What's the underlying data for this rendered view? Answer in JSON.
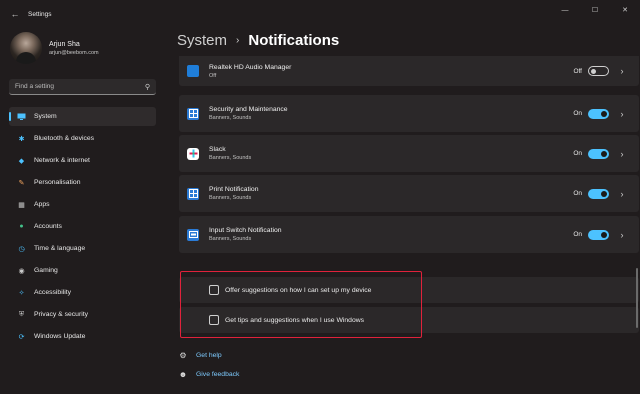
{
  "window": {
    "back_icon": "back-arrow-icon",
    "title": "Settings",
    "controls": [
      "minimize-icon",
      "maximize-icon",
      "close-icon"
    ]
  },
  "profile": {
    "name": "Arjun Sha",
    "email": "arjun@beebom.com"
  },
  "search": {
    "placeholder": "Find a setting",
    "value": "",
    "icon": "search-icon"
  },
  "sidebar": {
    "items": [
      {
        "label": "System",
        "icon": "system-icon",
        "active": true,
        "color": "#4cc2ff"
      },
      {
        "label": "Bluetooth & devices",
        "icon": "bluetooth-icon",
        "color": "#4cc2ff"
      },
      {
        "label": "Network & internet",
        "icon": "wifi-icon",
        "color": "#4cc2ff"
      },
      {
        "label": "Personalisation",
        "icon": "brush-icon",
        "color": "#f0a35e"
      },
      {
        "label": "Apps",
        "icon": "apps-icon",
        "color": "#c9c9c9"
      },
      {
        "label": "Accounts",
        "icon": "account-icon",
        "color": "#43c08a"
      },
      {
        "label": "Time & language",
        "icon": "globe-clock-icon",
        "color": "#4cc2ff"
      },
      {
        "label": "Gaming",
        "icon": "gamepad-icon",
        "color": "#c9c9c9"
      },
      {
        "label": "Accessibility",
        "icon": "accessibility-icon",
        "color": "#4cc2ff"
      },
      {
        "label": "Privacy & security",
        "icon": "shield-icon",
        "color": "#c9c9c9"
      },
      {
        "label": "Windows Update",
        "icon": "update-icon",
        "color": "#4cc2ff"
      }
    ]
  },
  "header": {
    "parent": "System",
    "separator": "›",
    "current": "Notifications"
  },
  "apps": [
    {
      "name": "Realtek HD Audio Manager",
      "sub": "Off",
      "state": "Off",
      "on": false,
      "icon": "realtek-icon",
      "icon_color": "#1f7ed9"
    },
    {
      "name": "Security and Maintenance",
      "sub": "Banners, Sounds",
      "state": "On",
      "on": true,
      "icon": "security-maintenance-icon",
      "icon_color": "#2a7bd6"
    },
    {
      "name": "Slack",
      "sub": "Banners, Sounds",
      "state": "On",
      "on": true,
      "icon": "slack-icon",
      "icon_color": "#ffffff"
    },
    {
      "name": "Print Notification",
      "sub": "Banners, Sounds",
      "state": "On",
      "on": true,
      "icon": "print-notification-icon",
      "icon_color": "#2a7bd6"
    },
    {
      "name": "Input Switch Notification",
      "sub": "Banners, Sounds",
      "state": "On",
      "on": true,
      "icon": "input-switch-icon",
      "icon_color": "#2a7bd6"
    }
  ],
  "checkboxes": [
    {
      "label": "Offer suggestions on how I can set up my device",
      "checked": false
    },
    {
      "label": "Get tips and suggestions when I use Windows",
      "checked": false
    }
  ],
  "links": [
    {
      "label": "Get help",
      "icon": "help-icon"
    },
    {
      "label": "Give feedback",
      "icon": "feedback-icon"
    }
  ],
  "colors": {
    "accent": "#4cc2ff",
    "highlight_box": "#e0223b",
    "background": "#201c1d",
    "card": "#2b2829"
  }
}
